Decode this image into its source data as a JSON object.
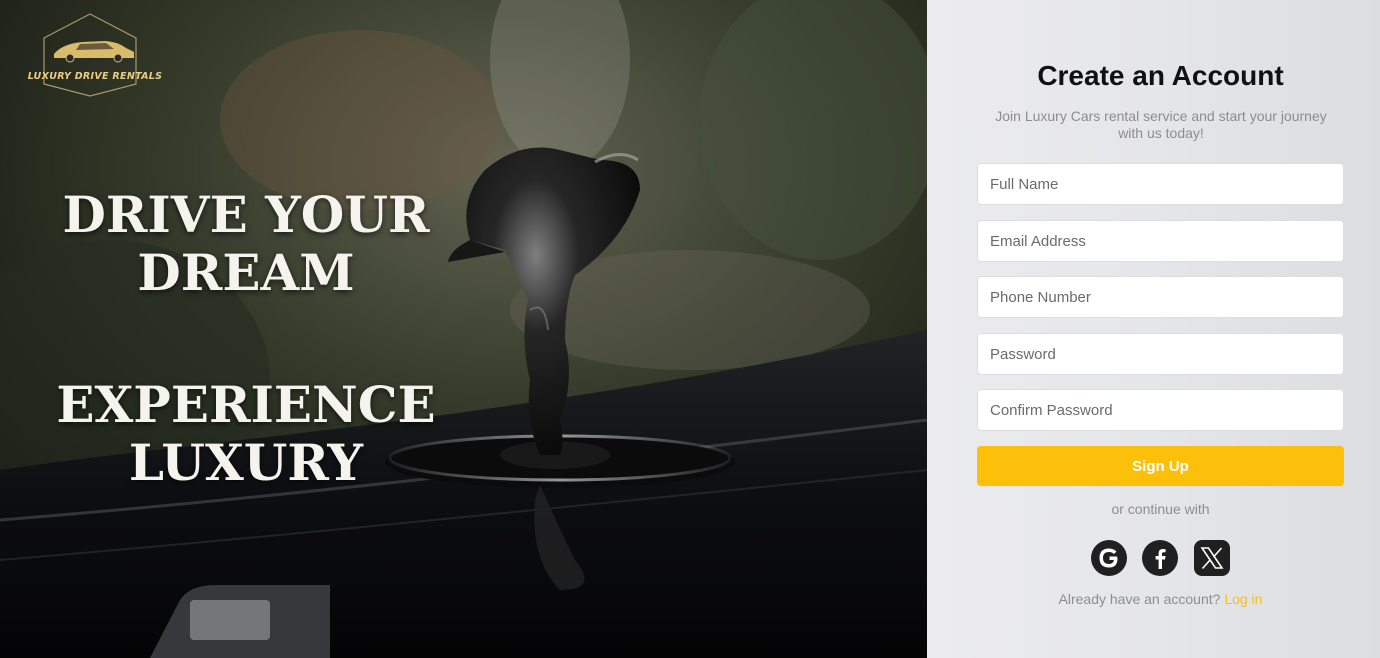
{
  "brand": {
    "logo_text": "LUXURY DRIVE RENTALS",
    "accent": "#fcbf0a",
    "logo_gold": "#e9cf82"
  },
  "hero": {
    "headline_1": [
      "DRIVE YOUR",
      "DREAM"
    ],
    "headline_2": [
      "EXPERIENCE",
      "LUXURY"
    ],
    "image": "car-hood-ornament-photo"
  },
  "form": {
    "title": "Create an Account",
    "subtitle": "Join Luxury Cars rental service and start your journey with us today!",
    "fields": {
      "full_name": {
        "placeholder": "Full Name",
        "value": ""
      },
      "email": {
        "placeholder": "Email Address",
        "value": ""
      },
      "phone": {
        "placeholder": "Phone Number",
        "value": ""
      },
      "password": {
        "placeholder": "Password",
        "value": ""
      },
      "confirm_password": {
        "placeholder": "Confirm Password",
        "value": ""
      }
    },
    "submit_label": "Sign Up",
    "divider": "or continue with",
    "social": [
      {
        "name": "google-icon",
        "glyph": "G"
      },
      {
        "name": "facebook-icon",
        "glyph": "f"
      },
      {
        "name": "x-icon",
        "glyph": "X"
      }
    ],
    "login_prompt": "Already have an account?",
    "login_link": "Log in"
  }
}
